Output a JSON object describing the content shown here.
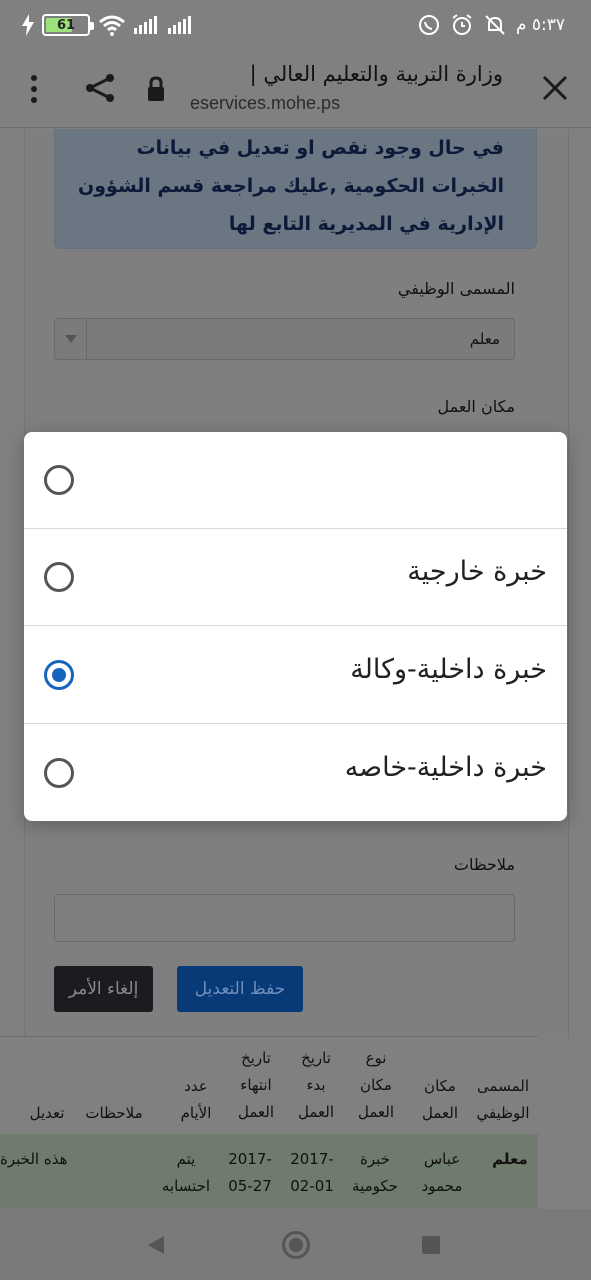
{
  "status_bar": {
    "battery_percent": "61",
    "time": "٥:٣٧ م",
    "left_icons": [
      "bolt-icon",
      "battery-icon",
      "wifi-icon",
      "signal-icon",
      "signal-icon"
    ],
    "right_icons": [
      "whatsapp-icon",
      "alarm-icon",
      "mute-icon"
    ]
  },
  "browser": {
    "title": "وزارة التربية والتعليم العالي |",
    "url": "eservices.mohe.ps"
  },
  "page": {
    "alert_lines": [
      "في حال وجود نقص او تعديل في بيانات",
      "الخبرات الحكومية ,عليك مراجعة قسم الشؤون",
      "الإدارية في المديرية التابع لها"
    ],
    "job_title_label": "المسمى الوظيفي",
    "job_title_value": "معلم",
    "workplace_label": "مكان العمل",
    "notes_label": "ملاحظات",
    "save_button": "حفظ التعديل",
    "cancel_button": "إلغاء الأمر"
  },
  "table": {
    "headers": {
      "job_title": [
        "المسمى",
        "الوظيفي"
      ],
      "workplace": [
        "مكان",
        "العمل"
      ],
      "workplace_type": [
        "نوع",
        "مكان",
        "العمل"
      ],
      "start_date": [
        "تاريخ",
        "بدء",
        "العمل"
      ],
      "end_date": [
        "تاريخ",
        "انتهاء",
        "العمل"
      ],
      "days": [
        "عدد",
        "الأيام"
      ],
      "notes": [
        "ملاحظات"
      ],
      "edit": [
        "تعديل"
      ]
    },
    "row": {
      "job_title": "معلم",
      "workplace": [
        "عباس",
        "محمود"
      ],
      "workplace_type": [
        "خبرة",
        "حكومية"
      ],
      "start_date": [
        "-2017",
        "02-01"
      ],
      "end_date": [
        "-2017",
        "05-27"
      ],
      "days": [
        "يتم",
        "احتسابه"
      ],
      "notes": "هذه الخبرة"
    }
  },
  "dialog": {
    "options": [
      {
        "label": "",
        "selected": false
      },
      {
        "label": "خبرة خارجية",
        "selected": false
      },
      {
        "label": "خبرة داخلية-وكالة",
        "selected": true
      },
      {
        "label": "خبرة داخلية-خاصه",
        "selected": false
      }
    ]
  },
  "colors": {
    "radio_selected": "#1565c0",
    "scrim": "#808080"
  }
}
